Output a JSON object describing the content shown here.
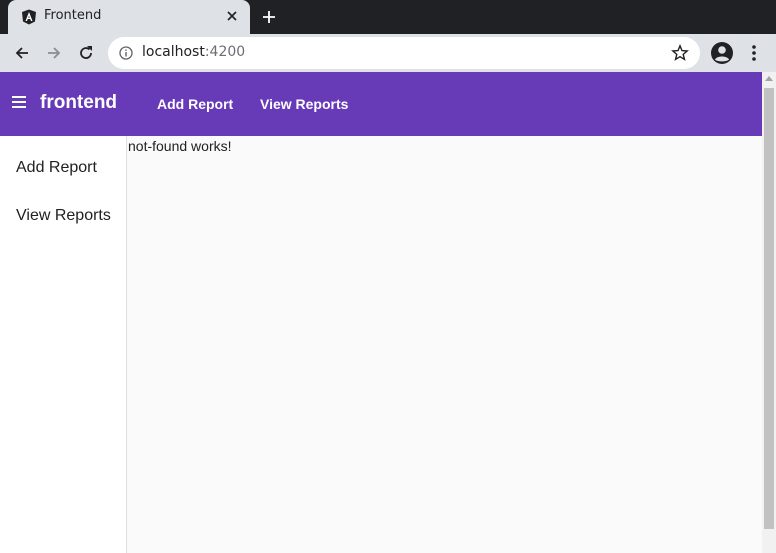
{
  "browser": {
    "tab_title": "Frontend",
    "url_host": "localhost",
    "url_port": ":4200"
  },
  "app": {
    "brand": "frontend",
    "top_nav": [
      "Add Report",
      "View Reports"
    ],
    "side_nav": [
      "Add Report",
      "View Reports"
    ],
    "content_text": "not-found works!"
  },
  "colors": {
    "toolbar": "#673ab7",
    "chrome_dark": "#202124",
    "chrome_light": "#dee1e6"
  }
}
